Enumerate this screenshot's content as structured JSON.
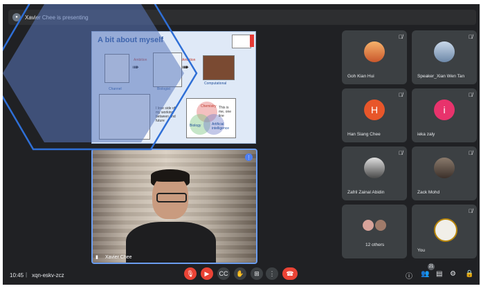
{
  "presenting": {
    "text": "Xavier Chee is presenting"
  },
  "slide": {
    "title": "A bit about myself",
    "labels": {
      "a1": "Ambition",
      "a2": "Ambition",
      "channel": "Channel",
      "biologist": "Biologist",
      "compbio": "Computational",
      "note": "I love side of my working between and future",
      "venn_top": "Chemistry",
      "venn_left": "Biology",
      "venn_right": "Artificial intelligence",
      "venn_note": "This is me, one line"
    }
  },
  "speaker": {
    "name": "Xavier Chee"
  },
  "participants": [
    {
      "name": "Goh Kian Hui",
      "avatar": "photo-sunset",
      "color": "#e0864a"
    },
    {
      "name": "Speaker_Xian Wen Tan",
      "avatar": "photo-mountain",
      "color": "#8fa7c0"
    },
    {
      "name": "Han Siang Chee",
      "avatar": "H",
      "color": "#e8562a"
    },
    {
      "name": "ieka zaly",
      "avatar": "i",
      "color": "#e8336c"
    },
    {
      "name": "Zafril Zainal Abidin",
      "avatar": "photo-person",
      "color": "#c9c9c9"
    },
    {
      "name": "Zack Mohd",
      "avatar": "photo-person",
      "color": "#6b5a4f"
    },
    {
      "name": "12 others",
      "avatar": "group",
      "color": "#d7a39a"
    },
    {
      "name": "You",
      "avatar": "photo-crest",
      "color": "#f1efe8"
    }
  ],
  "bottom": {
    "time": "10:45",
    "separator": "|",
    "meeting_code": "xqn-eskv-zcz",
    "participant_count": "21"
  },
  "icons": {
    "mic_off": "mic-off-icon",
    "cam_off": "cam-off-icon",
    "captions": "captions-icon",
    "hand": "raise-hand-icon",
    "present": "present-icon",
    "more": "more-icon",
    "end": "end-call-icon",
    "info": "info-icon",
    "people": "people-icon",
    "chat": "chat-icon",
    "activities": "activities-icon",
    "lock": "host-controls-icon"
  }
}
